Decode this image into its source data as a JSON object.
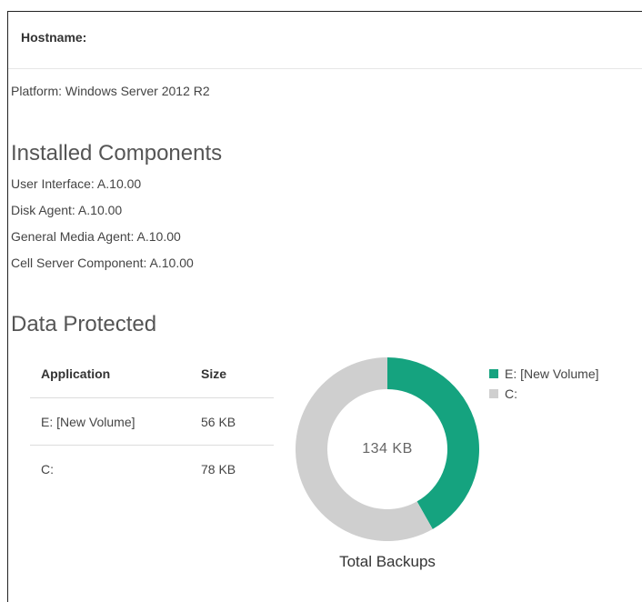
{
  "header": {
    "hostname_label": "Hostname:"
  },
  "platform": "Platform: Windows Server 2012 R2",
  "installed_components": {
    "title": "Installed Components",
    "items": [
      "User Interface: A.10.00",
      "Disk Agent: A.10.00",
      "General Media Agent: A.10.00",
      "Cell Server Component: A.10.00"
    ]
  },
  "data_protected": {
    "title": "Data Protected",
    "columns": [
      "Application",
      "Size"
    ],
    "rows": [
      {
        "application": "E: [New Volume]",
        "size": "56  KB"
      },
      {
        "application": "C:",
        "size": "78  KB"
      }
    ]
  },
  "donut": {
    "center_label": "134 KB",
    "caption": "Total Backups",
    "slices": [
      {
        "name": "E: [New Volume]",
        "value": 56,
        "color": "#15a37f"
      },
      {
        "name": "C:",
        "value": 78,
        "color": "#cfcfcf"
      }
    ]
  },
  "legend": [
    {
      "label": "E: [New Volume]",
      "color": "#15a37f"
    },
    {
      "label": "C:",
      "color": "#cfcfcf"
    }
  ]
}
